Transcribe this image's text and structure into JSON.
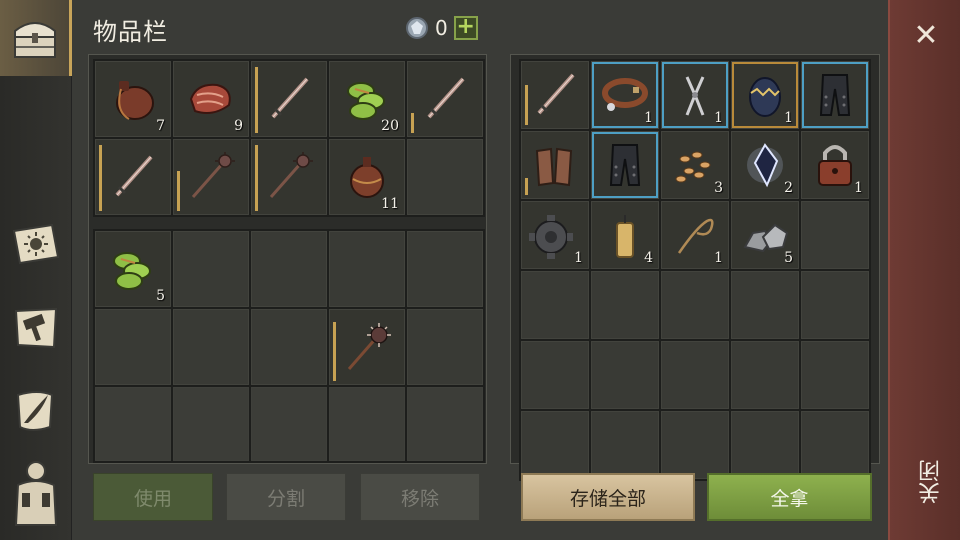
{
  "header": {
    "title": "物品栏",
    "currency_value": "0",
    "add_symbol": "+"
  },
  "sidebar": {
    "tabs": [
      {
        "id": "inventory",
        "icon": "chest-icon",
        "active": true
      },
      {
        "id": "recipes",
        "icon": "sun-book-icon",
        "active": false
      },
      {
        "id": "craft",
        "icon": "hammer-scroll-icon",
        "active": false
      },
      {
        "id": "quests",
        "icon": "quill-scroll-icon",
        "active": false
      },
      {
        "id": "character",
        "icon": "backpack-icon",
        "active": false
      }
    ]
  },
  "inventory_top": [
    {
      "item": "waterskin",
      "qty": "7"
    },
    {
      "item": "meat",
      "qty": "9"
    },
    {
      "item": "sword",
      "qty": "",
      "durability": 1.0
    },
    {
      "item": "green-bundle",
      "qty": "20"
    },
    {
      "item": "sword",
      "qty": "",
      "durability": 0.3
    },
    {
      "item": "sword",
      "qty": "",
      "durability": 1.0
    },
    {
      "item": "mace",
      "qty": "",
      "durability": 0.6
    },
    {
      "item": "mace",
      "qty": "",
      "durability": 1.0
    },
    {
      "item": "waterskin-round",
      "qty": "11"
    },
    {
      "item": "",
      "qty": ""
    }
  ],
  "inventory_bottom": [
    {
      "item": "green-bundle",
      "qty": "5"
    },
    {
      "item": "",
      "qty": ""
    },
    {
      "item": "",
      "qty": ""
    },
    {
      "item": "",
      "qty": ""
    },
    {
      "item": "",
      "qty": ""
    },
    {
      "item": "",
      "qty": ""
    },
    {
      "item": "",
      "qty": ""
    },
    {
      "item": "",
      "qty": ""
    },
    {
      "item": "spiked-mace",
      "qty": "",
      "durability": 0.9
    },
    {
      "item": "",
      "qty": ""
    }
  ],
  "storage": [
    {
      "item": "sword",
      "qty": "",
      "durability": 0.6
    },
    {
      "item": "collar",
      "qty": "1",
      "frame": "blue"
    },
    {
      "item": "pliers",
      "qty": "1",
      "frame": "blue"
    },
    {
      "item": "egg",
      "qty": "1",
      "frame": "gold"
    },
    {
      "item": "pants",
      "qty": "",
      "frame": "blue"
    },
    {
      "item": "chain-gloves",
      "qty": "",
      "durability": 0.25
    },
    {
      "item": "pants",
      "qty": "",
      "frame": "blue"
    },
    {
      "item": "seeds",
      "qty": "3"
    },
    {
      "item": "crystal",
      "qty": "2"
    },
    {
      "item": "padlock",
      "qty": "1"
    },
    {
      "item": "gear",
      "qty": "1"
    },
    {
      "item": "candle",
      "qty": "4"
    },
    {
      "item": "rope",
      "qty": "1"
    },
    {
      "item": "stones",
      "qty": "5"
    },
    {
      "item": "",
      "qty": ""
    }
  ],
  "buttons": {
    "use": "使用",
    "split": "分割",
    "remove": "移除",
    "store_all": "存储全部",
    "take_all": "全拿"
  },
  "close": {
    "label": "关闭",
    "x": "✕"
  }
}
